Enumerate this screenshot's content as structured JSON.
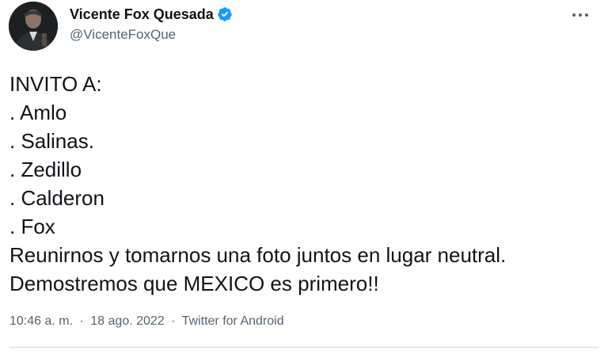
{
  "author": {
    "display_name": "Vicente Fox Quesada",
    "handle": "@VicenteFoxQue",
    "verified_icon": "verified-badge-icon",
    "avatar_icon": "avatar"
  },
  "menu": {
    "icon": "more-options-icon"
  },
  "tweet": {
    "lines": [
      "INVITO A:",
      ". Amlo",
      ". Salinas.",
      ". Zedillo",
      ". Calderon",
      ". Fox",
      "Reunirnos y tomarnos una foto juntos en lugar neutral.",
      "Demostremos que MEXICO es primero!!"
    ]
  },
  "meta": {
    "time": "10:46 a. m.",
    "separator": "·",
    "date": "18 ago. 2022",
    "source": "Twitter for Android"
  },
  "colors": {
    "verified": "#1d9bf0",
    "text": "#0f1419",
    "secondary": "#536471",
    "divider": "#cfd9de"
  }
}
